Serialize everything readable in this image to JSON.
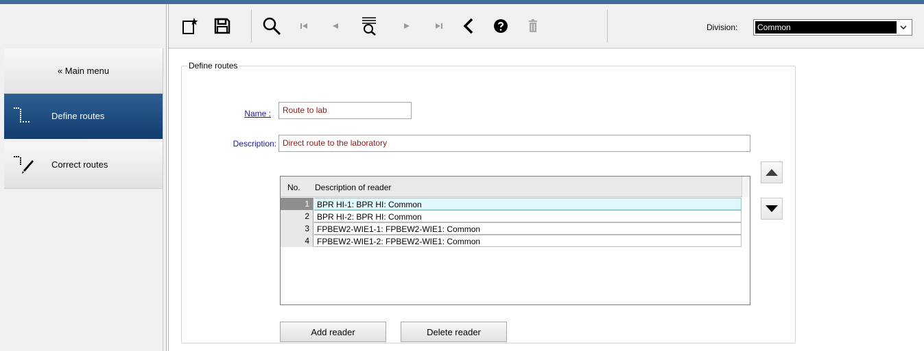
{
  "toolbar": {
    "buttons": [
      {
        "name": "new-icon"
      },
      {
        "name": "save-icon"
      },
      {
        "name": "search-icon"
      },
      {
        "name": "first-record-icon"
      },
      {
        "name": "previous-record-icon"
      },
      {
        "name": "list-search-icon"
      },
      {
        "name": "next-record-icon"
      },
      {
        "name": "last-record-icon"
      },
      {
        "name": "back-icon"
      },
      {
        "name": "help-icon"
      },
      {
        "name": "delete-icon"
      }
    ],
    "division_label": "Division:",
    "division_value": "Common"
  },
  "sidebar": {
    "main_menu_label": "« Main menu",
    "items": [
      {
        "label": "Define routes",
        "icon": "route-dotted-icon",
        "active": true
      },
      {
        "label": "Correct routes",
        "icon": "route-edit-icon",
        "active": false
      }
    ]
  },
  "form": {
    "group_title": "Define routes",
    "name_label": "Name :",
    "name_value": "Route to lab",
    "description_label": "Description:",
    "description_value": "Direct route to the laboratory"
  },
  "grid": {
    "columns": [
      "No.",
      "Description of reader"
    ],
    "rows": [
      {
        "no": "1",
        "description": "BPR HI-1: BPR HI: Common",
        "selected": true
      },
      {
        "no": "2",
        "description": "BPR HI-2: BPR HI: Common",
        "selected": false
      },
      {
        "no": "3",
        "description": "FPBEW2-WIE1-1: FPBEW2-WIE1: Common",
        "selected": false
      },
      {
        "no": "4",
        "description": "FPBEW2-WIE1-2: FPBEW2-WIE1: Common",
        "selected": false
      }
    ]
  },
  "actions": {
    "add_reader": "Add reader",
    "delete_reader": "Delete reader"
  },
  "colors": {
    "accent": "#1f4e80",
    "label_link": "#1a1a9a",
    "input_text": "#8b1a1a",
    "selected_row": "#e0f8fc"
  }
}
